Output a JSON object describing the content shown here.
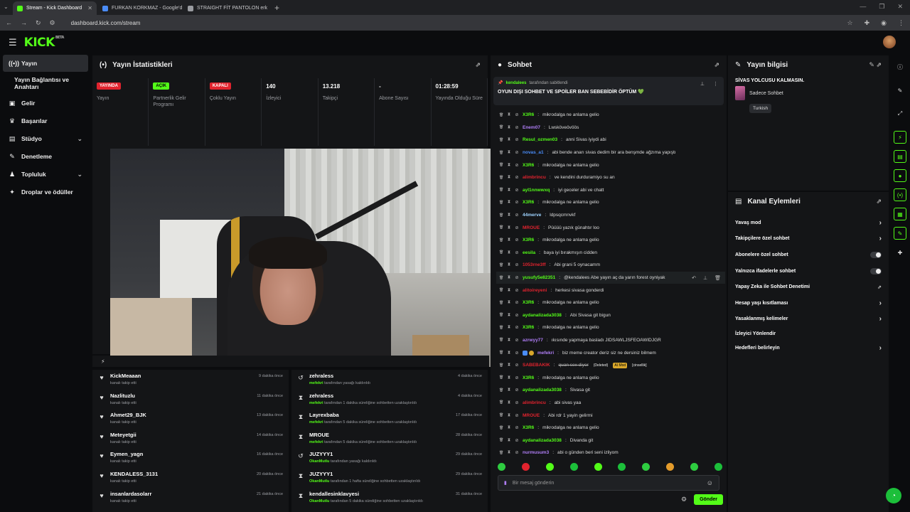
{
  "browser": {
    "tabs": [
      {
        "title": "Stream - Kick Dashboard",
        "color": "#53fc18",
        "active": true
      },
      {
        "title": "FURKAN KORKMAZ - Google'd",
        "color": "#4a8cf7",
        "active": false
      },
      {
        "title": "STRAIGHT FİT PANTOLON erkek",
        "color": "#9a9ca1",
        "active": false
      }
    ],
    "new_tab": "+",
    "url": "dashboard.kick.com/stream"
  },
  "app": {
    "logo": "KICK",
    "logo_sup": "BETA"
  },
  "sidebar": {
    "items": [
      {
        "label": "Yayın",
        "icon": "broadcast-icon",
        "glyph": "((•))",
        "active": true
      },
      {
        "label": "Yayın Bağlantısı ve Anahtarı",
        "icon": "",
        "glyph": "",
        "sub": true
      },
      {
        "label": "Gelir",
        "icon": "money-icon",
        "glyph": "▣"
      },
      {
        "label": "Başarılar",
        "icon": "trophy-icon",
        "glyph": "♛"
      },
      {
        "label": "Stüdyo",
        "icon": "studio-icon",
        "glyph": "▤",
        "chev": "⌄"
      },
      {
        "label": "Denetleme",
        "icon": "wrench-icon",
        "glyph": "✎"
      },
      {
        "label": "Topluluk",
        "icon": "community-icon",
        "glyph": "♟",
        "chev": "⌄"
      },
      {
        "label": "Droplar ve ödüller",
        "icon": "gift-icon",
        "glyph": "✦"
      }
    ]
  },
  "stats": {
    "title": "Yayın İstatistikleri",
    "items": [
      {
        "badge": "YAYINDA",
        "badge_color": "red",
        "label": "Yayın"
      },
      {
        "badge": "AÇIK",
        "badge_color": "green",
        "label": "Partnerlik Gelir Programı"
      },
      {
        "badge": "KAPALI",
        "badge_color": "red",
        "label": "Çoklu Yayın"
      },
      {
        "value": "140",
        "label": "İzleyici"
      },
      {
        "value": "13.218",
        "label": "Takipçi"
      },
      {
        "value": "-",
        "label": "Abone Sayısı"
      },
      {
        "value": "01:28:59",
        "label": "Yayında Olduğu Süre"
      }
    ]
  },
  "followers_feed": [
    {
      "name": "KickMeaaan",
      "sub": "kanalı takip etti",
      "time": "9 dakika önce"
    },
    {
      "name": "Nazlituzlu",
      "sub": "kanalı takip etti",
      "time": "11 dakika önce"
    },
    {
      "name": "Ahmet29_BJK",
      "sub": "kanalı takip etti",
      "time": "13 dakika önce"
    },
    {
      "name": "Meteyetgii",
      "sub": "kanalı takip etti",
      "time": "14 dakika önce"
    },
    {
      "name": "Eymen_yagn",
      "sub": "kanalı takip etti",
      "time": "16 dakika önce"
    },
    {
      "name": "KENDALESS_3131",
      "sub": "kanalı takip etti",
      "time": "20 dakika önce"
    },
    {
      "name": "insanlardasolarr",
      "sub": "kanalı takip etti",
      "time": "21 dakika önce"
    }
  ],
  "mod_feed": [
    {
      "type": "unban",
      "name": "zehraless",
      "mod": "mefekri",
      "sub": "tarafından yasağı kaldırıldı",
      "time": "4 dakika önce"
    },
    {
      "type": "timeout",
      "name": "zehraless",
      "mod": "mefekri",
      "sub": "tarafından 1 dakika süreliğine sohbetten uzaklaştırıldı",
      "time": "4 dakika önce"
    },
    {
      "type": "timeout",
      "name": "Layrexbaba",
      "mod": "mefekri",
      "sub": "tarafından 5 dakika süreliğine sohbetten uzaklaştırıldı",
      "time": "17 dakika önce"
    },
    {
      "type": "timeout",
      "name": "MROUE",
      "mod": "mefekri",
      "sub": "tarafından 5 dakika süreliğine sohbetten uzaklaştırıldı",
      "time": "28 dakika önce"
    },
    {
      "type": "unban",
      "name": "JUZYYY1",
      "mod": "OkanMutlu",
      "sub": "tarafından yasağı kaldırıldı",
      "time": "29 dakika önce"
    },
    {
      "type": "timeout",
      "name": "JUZYYY1",
      "mod": "OkanMutlu",
      "sub": "tarafından 1 hafta süreliğine sohbetten uzaklaştırıldı",
      "time": "29 dakika önce"
    },
    {
      "type": "timeout",
      "name": "kendallesinklavyesi",
      "mod": "OkanMutlu",
      "sub": "tarafından 5 dakika süreliğine sohbetten uzaklaştırıldı",
      "time": "31 dakika önce"
    }
  ],
  "chat": {
    "title": "Sohbet",
    "pinned": {
      "by": "kendalees",
      "by_suffix": "tarafından sabitlendi",
      "text": "OYUN DIŞI SOHBET VE SPOİLER BAN SEBEBİDİR ÖPTÜM 💚"
    },
    "messages": [
      {
        "user": "X3R6",
        "color": "#53fc18",
        "text": "mikrodalga ne anlama gelio"
      },
      {
        "user": "Enem07",
        "color": "#b07ef7",
        "text": "Lwsköveövöös"
      },
      {
        "user": "Resul_ozmen03",
        "color": "#53fc18",
        "text": "anni Sivas iyiydi abi"
      },
      {
        "user": "novas_a1",
        "color": "#4a8cf7",
        "text": "abi bende anarı sivas dedim bir ara benşmde ağzıma yapıştı"
      },
      {
        "user": "X3R6",
        "color": "#53fc18",
        "text": "mikrodalga ne anlama gelio"
      },
      {
        "user": "alimbrincu",
        "color": "#e1232e",
        "text": "ve kendini durduramiyo su an"
      },
      {
        "user": "ayl1nnwwxq",
        "color": "#53fc18",
        "text": "iyi geceler abi ve chatt"
      },
      {
        "user": "X3R6",
        "color": "#53fc18",
        "text": "mikrodalga ne anlama gelio"
      },
      {
        "user": "44merve",
        "color": "#9ed3ff",
        "text": "ldpsqcmnvkf"
      },
      {
        "user": "MROUE",
        "color": "#e1232e",
        "text": "Püüüü yazık günahtır loo"
      },
      {
        "user": "X3R6",
        "color": "#53fc18",
        "text": "mikrodalga ne anlama gelio"
      },
      {
        "user": "eesila",
        "color": "#53fc18",
        "text": "baya iyi bırakmışın cidden"
      },
      {
        "user": "1053rne3ff",
        "color": "#e1232e",
        "text": "Abi grani 5 oynacamm"
      },
      {
        "user": "yusufy5e82351",
        "color": "#53fc18",
        "text": "@kendalees Abe yayın aç da yarın forest oyniyak",
        "highlight": true
      },
      {
        "user": "alitoireyeni",
        "color": "#e1232e",
        "text": "herkesi sivasa gonderdi"
      },
      {
        "user": "X3R6",
        "color": "#53fc18",
        "text": "mikrodalga ne anlama gelio"
      },
      {
        "user": "aydanalizada3038",
        "color": "#53fc18",
        "text": "Abi Sivasa git bigun"
      },
      {
        "user": "X3R6",
        "color": "#53fc18",
        "text": "mikrodalga ne anlama gelio"
      },
      {
        "user": "azrwyy77",
        "color": "#b07ef7",
        "text": "ıkısınde yapmaya basladı JIDSAWLJSFEOAWIDJGR"
      },
      {
        "user": "mefekri",
        "color": "#b07ef7",
        "text": "biz meme creator deriz siz ne dersiniz bilmem",
        "badges": true
      },
      {
        "user": "SABEBAKIK",
        "color": "#e1232e",
        "text": "quan sex diyor",
        "deleted": true,
        "tag1": "(Deleted)",
        "tag2": "AI Mod",
        "tag3": "[cinsellik]"
      },
      {
        "user": "X3R6",
        "color": "#53fc18",
        "text": "mikrodalga ne anlama gelio"
      },
      {
        "user": "aydanalizada3038",
        "color": "#53fc18",
        "text": "Sivasa git"
      },
      {
        "user": "alimbrincu",
        "color": "#e1232e",
        "text": "abi sivas yaa"
      },
      {
        "user": "MROUE",
        "color": "#e1232e",
        "text": "Abi rdr 1 yayin gelirmi"
      },
      {
        "user": "X3R6",
        "color": "#53fc18",
        "text": "mikrodalga ne anlama gelio"
      },
      {
        "user": "aydanalizada3038",
        "color": "#53fc18",
        "text": "Divanda git"
      },
      {
        "user": "nurmusum3",
        "color": "#b07ef7",
        "text": "abi o günden beri seni izliyom"
      }
    ],
    "emote_colors": [
      "#2ecc40",
      "#e1232e",
      "#53fc18",
      "#1cbf3a",
      "#53fc18",
      "#1cbf3a",
      "#2ecc40",
      "#e39b2b",
      "#2ecc40",
      "#1cbf3a"
    ],
    "input_placeholder": "Bir mesaj gönderin",
    "send_label": "Gönder"
  },
  "stream_info": {
    "title_header": "Yayın bilgisi",
    "stream_title": "SİVAS YOLCUSU KALMASIN.",
    "category": "Sadece Sohbet",
    "language": "Turkish"
  },
  "channel_actions": {
    "title": "Kanal Eylemleri",
    "items": [
      {
        "label": "Yavaş mod",
        "control": "arrow"
      },
      {
        "label": "Takipçilere özel sohbet",
        "control": "arrow"
      },
      {
        "label": "Abonelere özel sohbet",
        "control": "toggle"
      },
      {
        "label": "Yalnızca ifadelerle sohbet",
        "control": "toggle"
      },
      {
        "label": "Yapay Zeka ile Sohbet Denetimi",
        "control": "external"
      },
      {
        "label": "Hesap yaşı kısıtlaması",
        "control": "arrow"
      },
      {
        "label": "Yasaklanmış kelimeler",
        "control": "arrow"
      },
      {
        "label": "İzleyici Yönlendir",
        "control": "none"
      },
      {
        "label": "Hedefleri belirleyin",
        "control": "arrow"
      }
    ]
  },
  "accent": "#53fc18"
}
